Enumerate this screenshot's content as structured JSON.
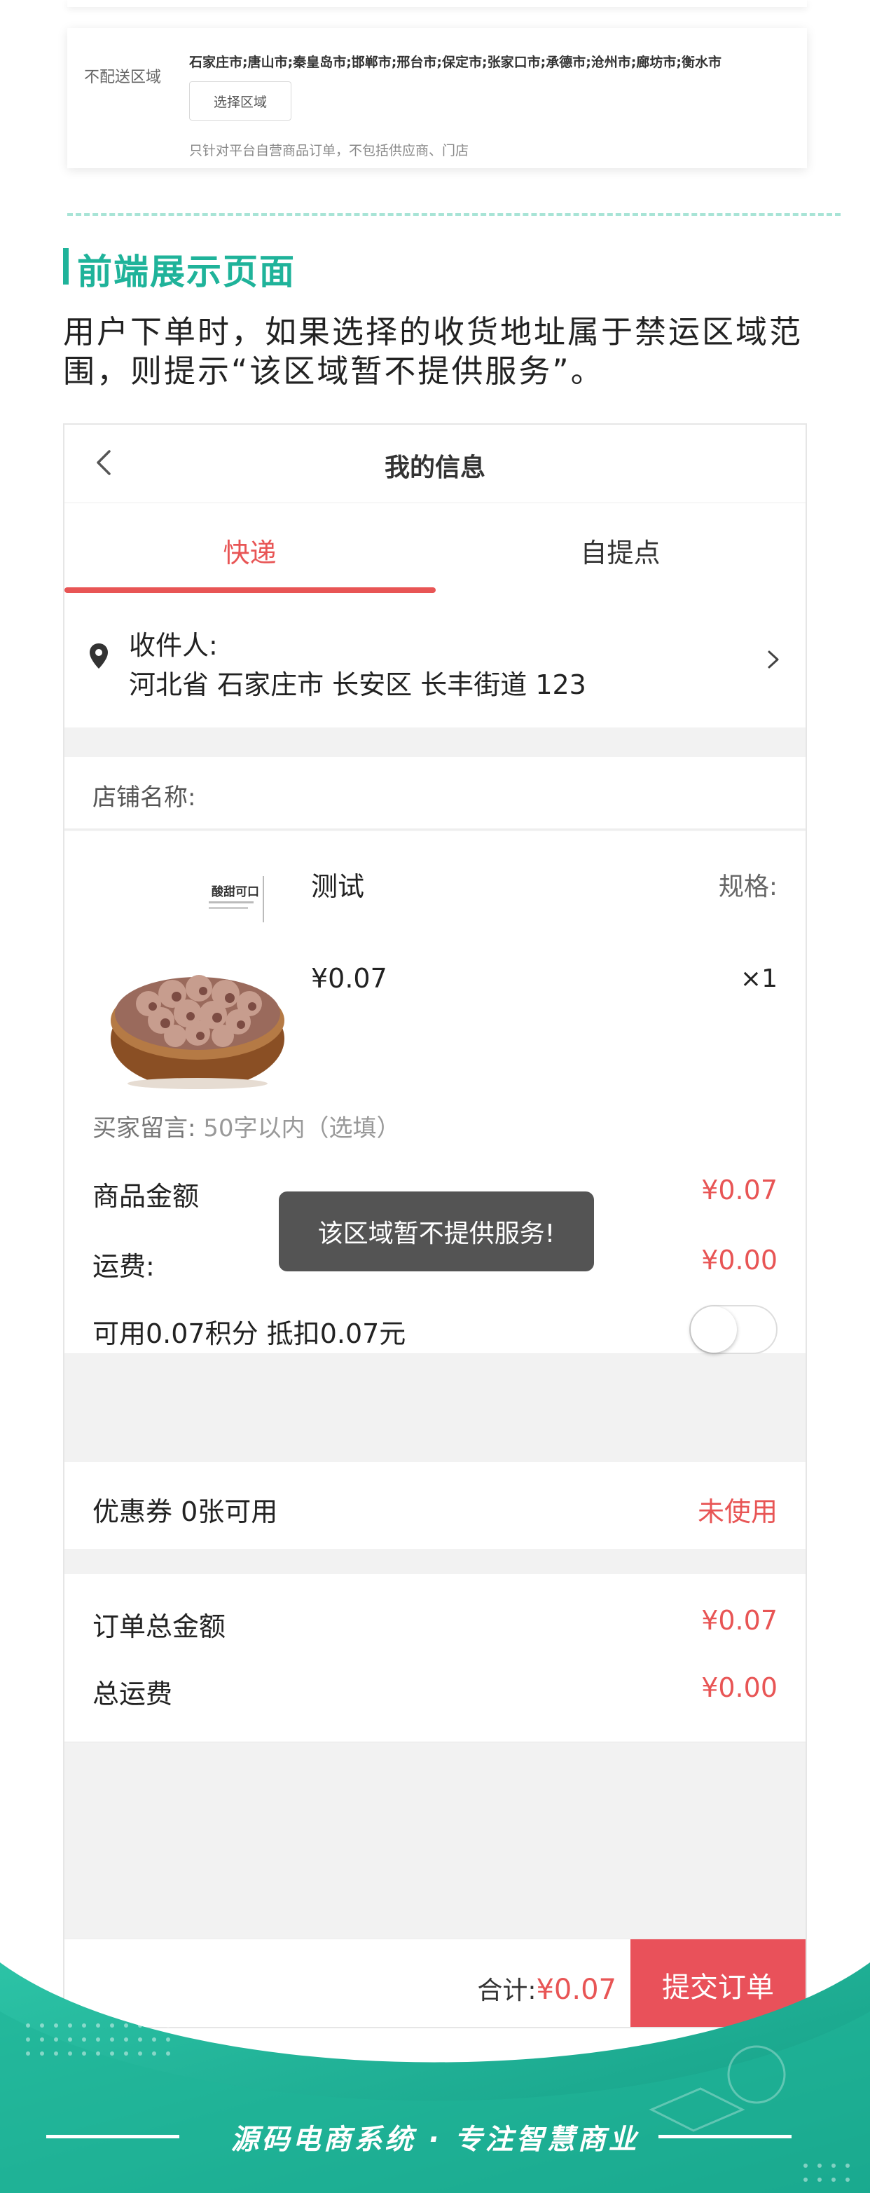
{
  "config": {
    "label": "不配送区域",
    "cities": "石家庄市;唐山市;秦皇岛市;邯郸市;邢台市;保定市;张家口市;承德市;沧州市;廊坊市;衡水市",
    "select_button": "选择区域",
    "note": "只针对平台自营商品订单，不包括供应商、门店"
  },
  "section": {
    "title": "前端展示页面",
    "description": "用户下单时，如果选择的收货地址属于禁运区域范围，则提示“该区域暂不提供服务”。"
  },
  "phone": {
    "nav_title": "我的信息",
    "tabs": [
      {
        "label": "快递"
      },
      {
        "label": "自提点"
      }
    ],
    "address": {
      "receiver_prefix": "收件人:",
      "line": "河北省 石家庄市 长安区 长丰街道 123"
    },
    "shop_label": "店铺名称:",
    "goods": {
      "name": "测试",
      "spec_label": "规格:",
      "price": "¥0.07",
      "qty": "×1",
      "image_text": "酸甜可口",
      "message_label": "买家留言:",
      "message_placeholder": "50字以内（选填）"
    },
    "fees": {
      "goods_amount_label": "商品金额",
      "goods_amount": "¥0.07",
      "freight_label": "运费:",
      "freight": "¥0.00",
      "points_label": "可用0.07积分 抵扣0.07元"
    },
    "coupon": {
      "label": "优惠券 0张可用",
      "status": "未使用"
    },
    "totals": {
      "order_total_label": "订单总金额",
      "order_total": "¥0.07",
      "freight_total_label": "总运费",
      "freight_total": "¥0.00"
    },
    "toast": "该区域暂不提供服务!",
    "bottom": {
      "sum_label": "合计:",
      "sum_amount": "¥0.07",
      "submit": "提交订单"
    }
  },
  "footer": {
    "slogan": "源码电商系统 · 专注智慧商业"
  },
  "colors": {
    "accent": "#1fb39a",
    "price_red": "#e85555",
    "submit_red": "#e9515a"
  }
}
